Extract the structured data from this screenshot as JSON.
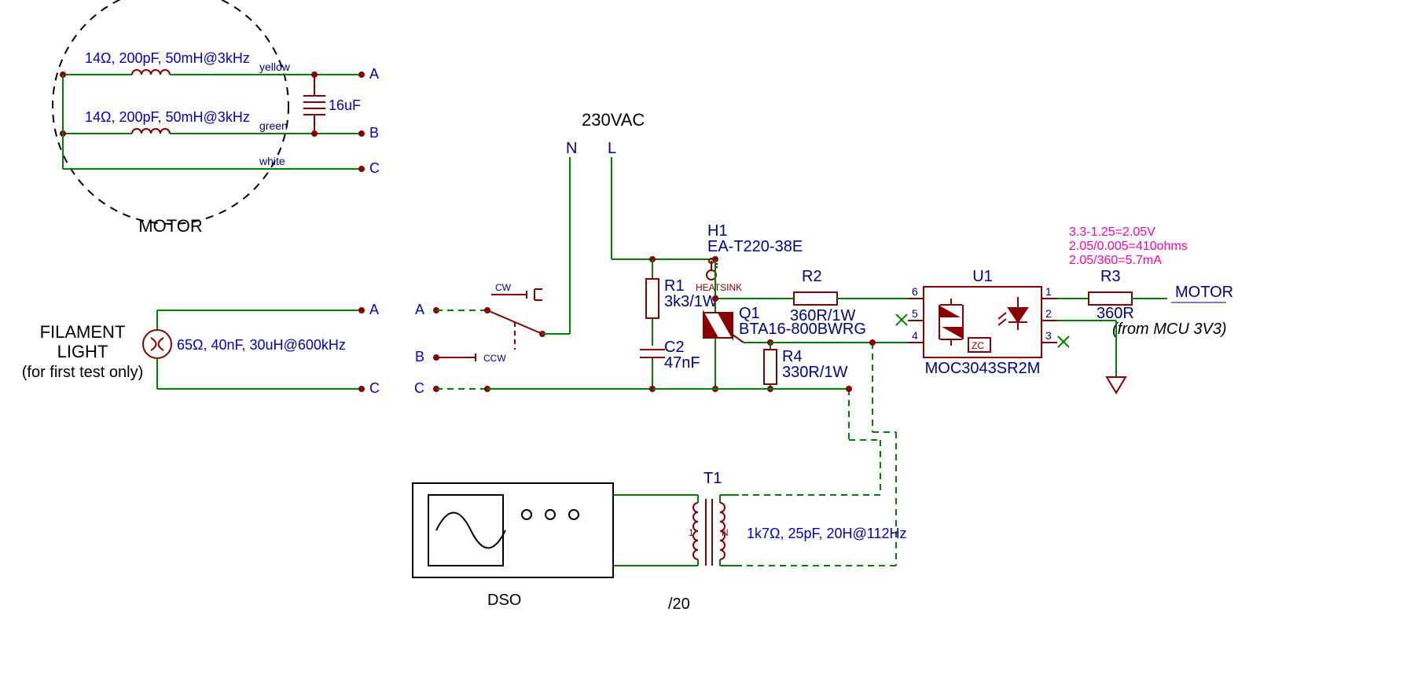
{
  "motor_block": {
    "label": "MOTOR",
    "winding1": "14Ω, 200pF, 50mH@3kHz",
    "winding2": "14Ω, 200pF, 50mH@3kHz",
    "wire_yellow": "yellow",
    "wire_green": "green",
    "wire_white": "white",
    "cap": "16uF",
    "netA": "A",
    "netB": "B",
    "netC": "C"
  },
  "filament": {
    "label1": "FILAMENT",
    "label2": "LIGHT",
    "label3": "(for first test only)",
    "params": "65Ω, 40nF, 30uH@600kHz",
    "netA": "A",
    "netC": "C"
  },
  "switch": {
    "netA": "A",
    "netB": "B",
    "netC": "C",
    "cw": "CW",
    "ccw": "CCW"
  },
  "mains": {
    "label": "230VAC",
    "N": "N",
    "L": "L"
  },
  "R1": {
    "ref": "R1",
    "val": "3k3/1W"
  },
  "C2": {
    "ref": "C2",
    "val": "47nF"
  },
  "H1": {
    "ref": "H1",
    "val": "EA-T220-38E",
    "note": "HEATSINK"
  },
  "Q1": {
    "ref": "Q1",
    "val": "BTA16-800BWRG"
  },
  "R2": {
    "ref": "R2",
    "val": "360R/1W"
  },
  "R4": {
    "ref": "R4",
    "val": "330R/1W"
  },
  "U1": {
    "ref": "U1",
    "val": "MOC3043SR2M",
    "zc": "ZC",
    "p1": "1",
    "p2": "2",
    "p3": "3",
    "p4": "4",
    "p5": "5",
    "p6": "6"
  },
  "R3": {
    "ref": "R3",
    "val": "360R"
  },
  "motor_net": "MOTOR",
  "mcu_note": "(from MCU 3V3)",
  "calc": {
    "l1": "3.3-1.25=2.05V",
    "l2": "2.05/0.005=410ohms",
    "l3": "2.05/360=5.7mA"
  },
  "dso": {
    "label": "DSO"
  },
  "T1": {
    "ref": "T1",
    "params": "1k7Ω, 25pF, 20H@112Hz",
    "ratio": "/20",
    "p1": "1",
    "pN": "N"
  }
}
